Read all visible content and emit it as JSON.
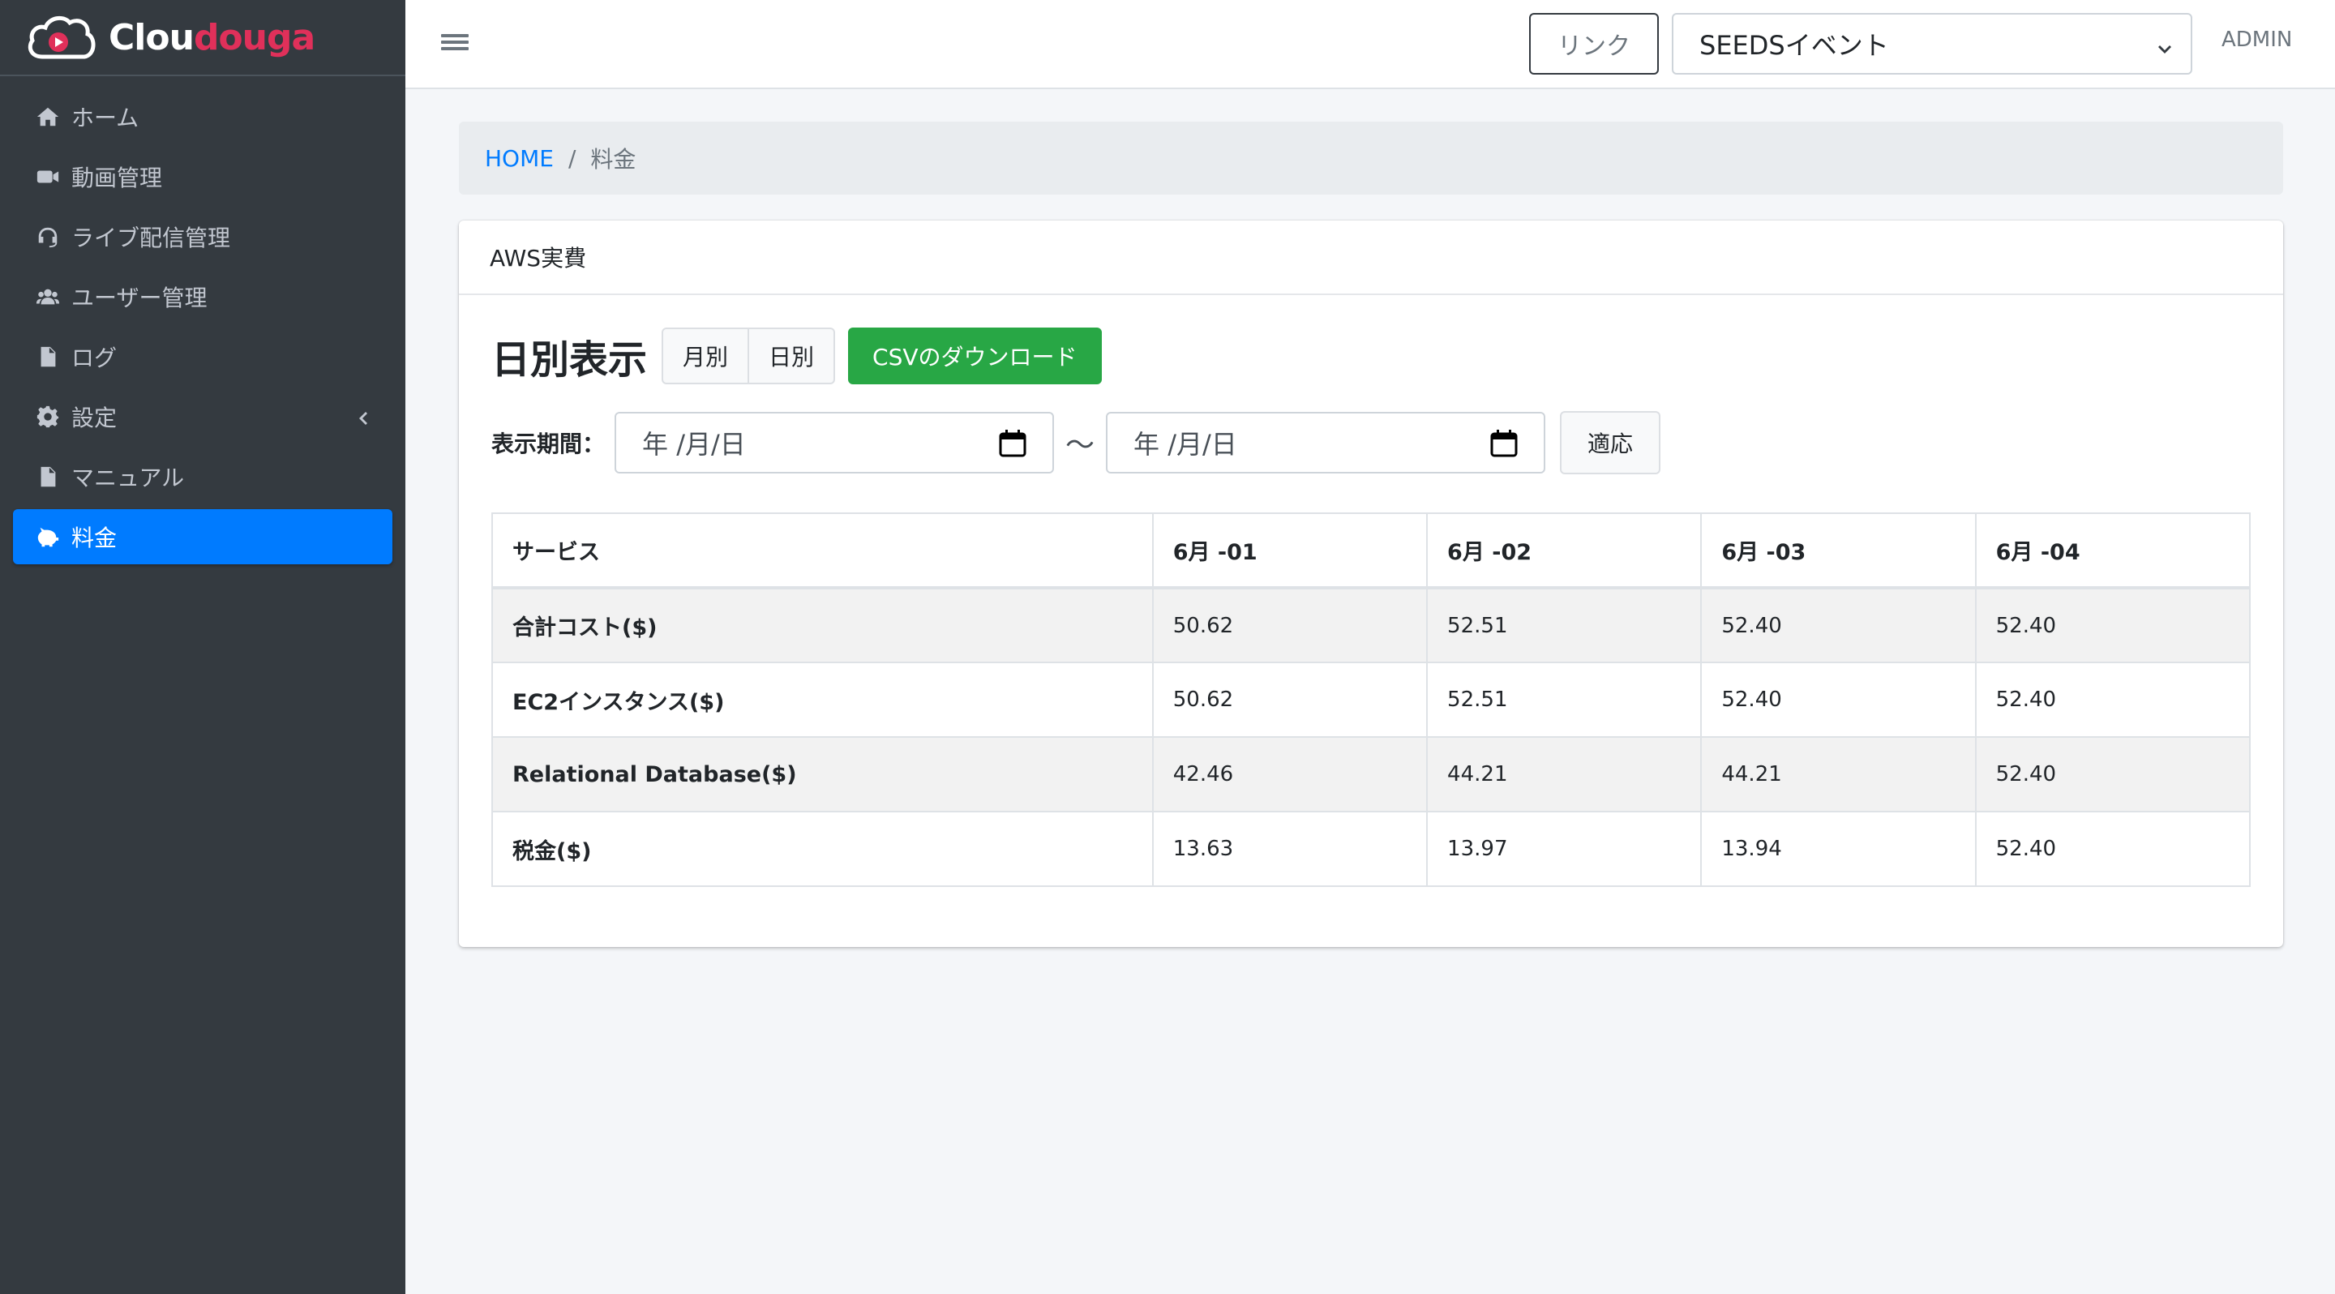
{
  "brand": {
    "prefix": "Clou",
    "suffix": "douga",
    "accent_color": "#e0305a"
  },
  "sidebar": {
    "items": [
      {
        "label": "ホーム",
        "icon": "home-icon"
      },
      {
        "label": "動画管理",
        "icon": "video-icon"
      },
      {
        "label": "ライブ配信管理",
        "icon": "headset-icon"
      },
      {
        "label": "ユーザー管理",
        "icon": "users-icon"
      },
      {
        "label": "ログ",
        "icon": "file-icon"
      },
      {
        "label": "設定",
        "icon": "gear-icon"
      },
      {
        "label": "マニュアル",
        "icon": "file-icon"
      },
      {
        "label": "料金",
        "icon": "piggy-bank-icon"
      }
    ],
    "active_index": 7,
    "active_color": "#007bff"
  },
  "topbar": {
    "link_label": "リンク",
    "event_selected": "SEEDSイベント",
    "user": "ADMIN"
  },
  "breadcrumb": {
    "home": "HOME",
    "separator": "/",
    "current": "料金"
  },
  "card": {
    "header": "AWS実費",
    "heading": "日別表示",
    "toggle": {
      "monthly": "月別",
      "daily": "日別"
    },
    "csv_button": "CSVのダウンロード",
    "period_label": "表示期間：",
    "date_from_placeholder": "年 /月/日",
    "date_to_placeholder": "年 /月/日",
    "tilde": "〜",
    "apply_button": "適応"
  },
  "table": {
    "headers": [
      "サービス",
      "6月 -01",
      "6月 -02",
      "6月 -03",
      "6月 -04"
    ],
    "rows": [
      [
        "合計コスト($)",
        "50.62",
        "52.51",
        "52.40",
        "52.40"
      ],
      [
        "EC2インスタンス($)",
        "50.62",
        "52.51",
        "52.40",
        "52.40"
      ],
      [
        "Relational Database($)",
        "42.46",
        "44.21",
        "44.21",
        "52.40"
      ],
      [
        "税金($)",
        "13.63",
        "13.97",
        "13.94",
        "52.40"
      ]
    ]
  }
}
